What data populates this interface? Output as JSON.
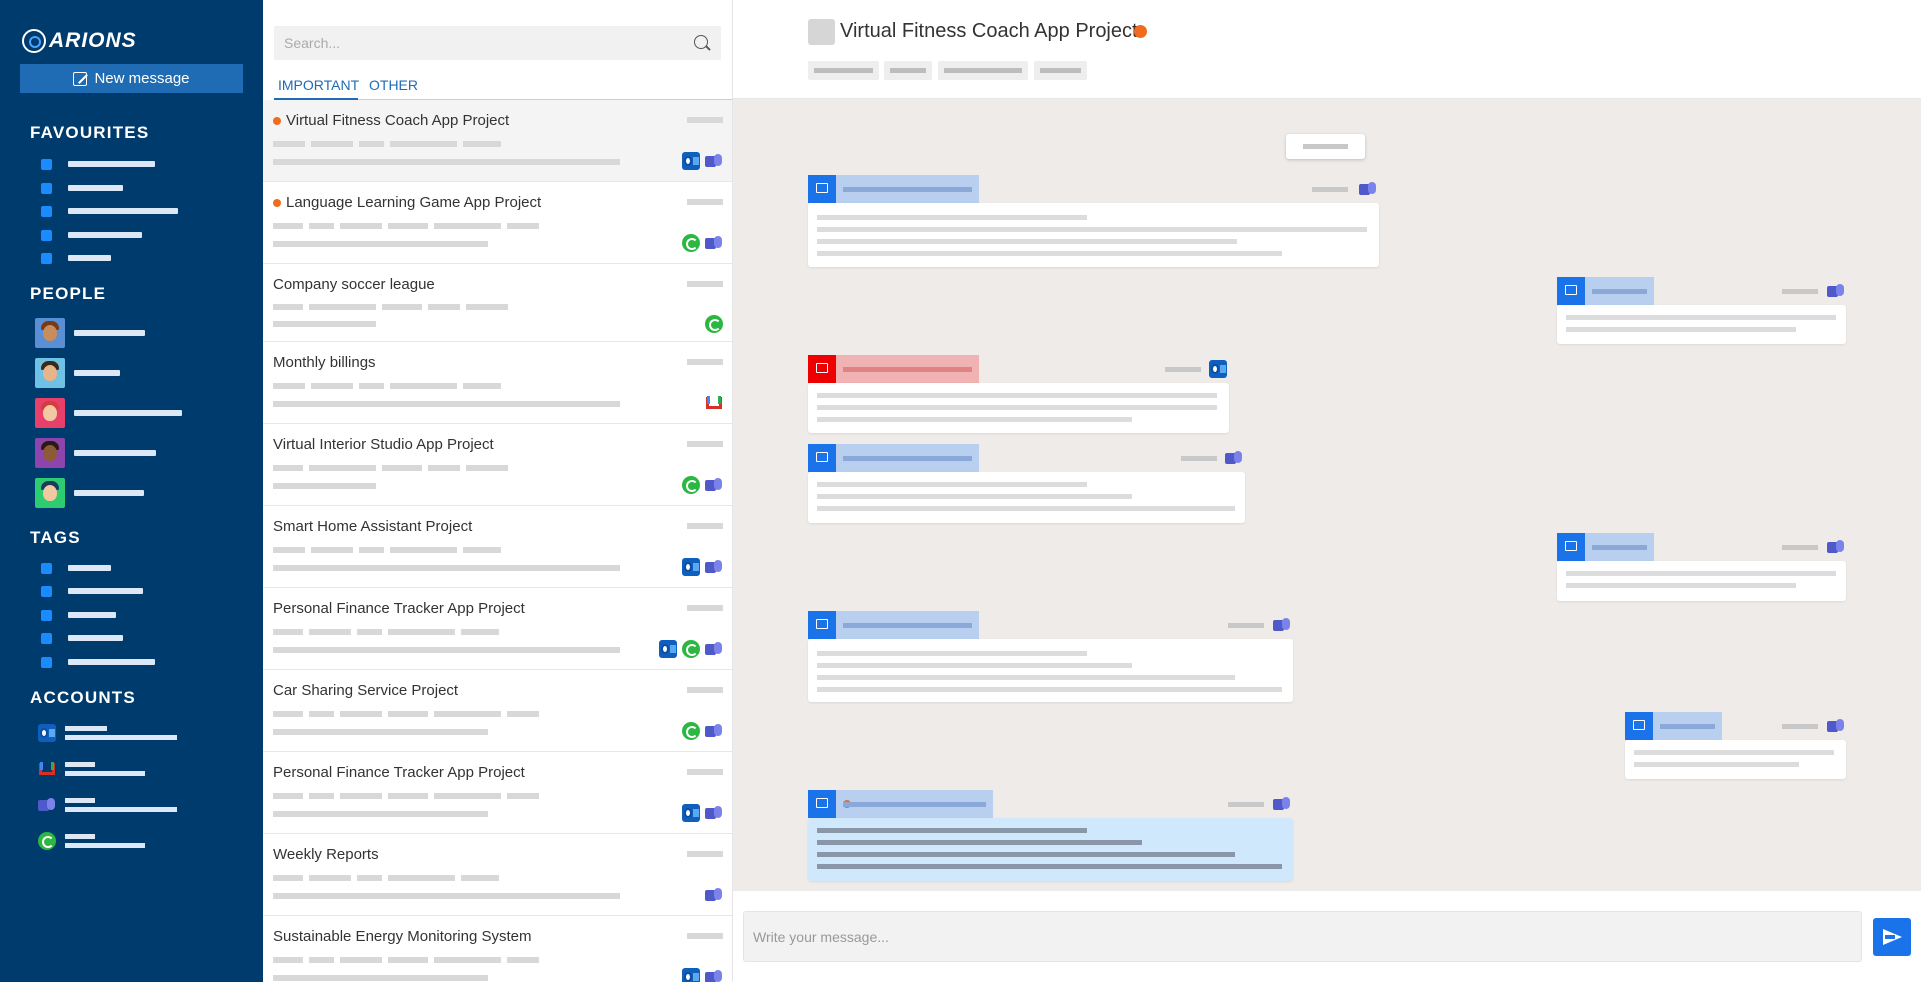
{
  "app": {
    "logo_text": "ARIONS",
    "new_message_label": "New message",
    "favourites_title": "FAVOURITES",
    "people_title": "PEOPLE",
    "tags_title": "TAGS",
    "accounts_title": "ACCOUNTS"
  },
  "accent_colors": {
    "sidebar_bg": "#003b6e",
    "primary": "#1f6bb4",
    "important_dot": "#f26b1d",
    "chat_bg": "#efebe8"
  },
  "search": {
    "placeholder": "Search..."
  },
  "tabs": [
    {
      "label": "IMPORTANT",
      "active": true
    },
    {
      "label": "OTHER",
      "active": false
    }
  ],
  "conversations": [
    {
      "title": "Virtual Fitness Coach App Project",
      "important": true,
      "selected": true,
      "sources": [
        "outlook-icon",
        "teams-icon"
      ]
    },
    {
      "title": "Language Learning Game App Project",
      "important": true,
      "selected": false,
      "sources": [
        "whatsapp-icon",
        "teams-icon"
      ]
    },
    {
      "title": "Company soccer league",
      "important": false,
      "selected": false,
      "sources": [
        "whatsapp-icon"
      ]
    },
    {
      "title": "Monthly billings",
      "important": false,
      "selected": false,
      "sources": [
        "gmail-icon"
      ]
    },
    {
      "title": "Virtual Interior Studio App Project",
      "important": false,
      "selected": false,
      "sources": [
        "whatsapp-icon",
        "teams-icon"
      ]
    },
    {
      "title": "Smart Home Assistant Project",
      "important": false,
      "selected": false,
      "sources": [
        "outlook-icon",
        "teams-icon"
      ]
    },
    {
      "title": "Personal Finance Tracker App Project",
      "important": false,
      "selected": false,
      "sources": [
        "outlook-icon",
        "whatsapp-icon",
        "teams-icon"
      ]
    },
    {
      "title": "Car Sharing Service Project",
      "important": false,
      "selected": false,
      "sources": [
        "whatsapp-icon",
        "teams-icon"
      ]
    },
    {
      "title": "Personal Finance Tracker App Project",
      "important": false,
      "selected": false,
      "sources": [
        "outlook-icon",
        "teams-icon"
      ]
    },
    {
      "title": "Weekly Reports",
      "important": false,
      "selected": false,
      "sources": [
        "teams-icon"
      ]
    },
    {
      "title": "Sustainable Energy Monitoring System",
      "important": false,
      "selected": false,
      "sources": [
        "outlook-icon",
        "teams-icon"
      ]
    }
  ],
  "chat": {
    "title": "Virtual Fitness Coach App Project",
    "important": true,
    "compose_placeholder": "Write your message..."
  }
}
